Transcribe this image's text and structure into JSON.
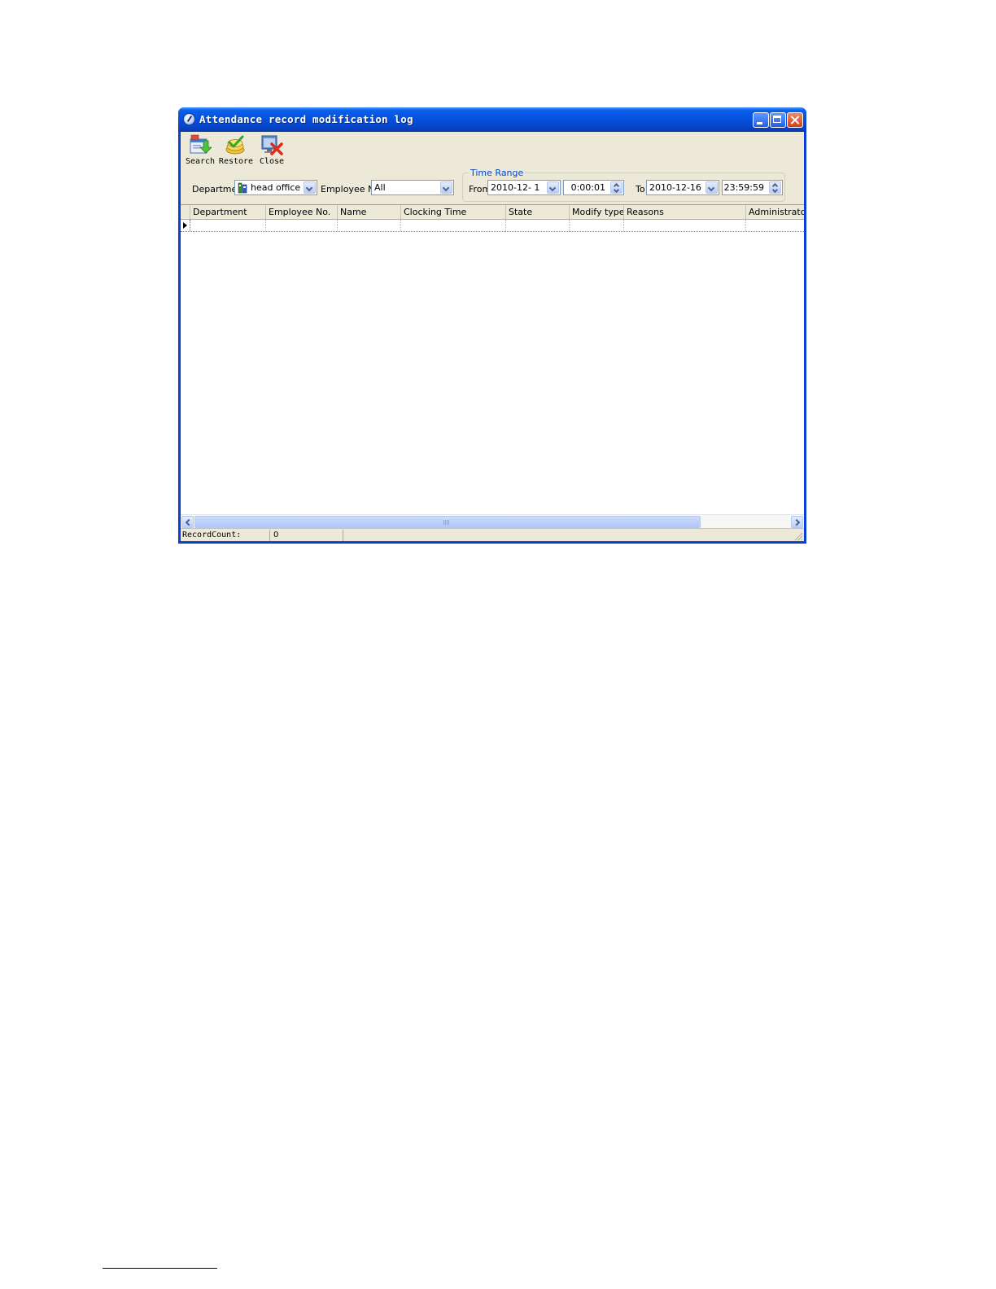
{
  "window": {
    "title": "Attendance record modification log"
  },
  "toolbar": {
    "search_label": "Search",
    "restore_label": "Restore",
    "close_label": "Close"
  },
  "filters": {
    "department_label": "Department",
    "department_value": "head office",
    "employee_label": "Employee No.",
    "employee_value": "All",
    "time_range_label": "Time Range",
    "from_label": "From",
    "from_date": "2010-12- 1",
    "from_time": "0:00:01",
    "to_label": "To",
    "to_date": "2010-12-16",
    "to_time": "23:59:59"
  },
  "grid": {
    "columns": [
      "Department",
      "Employee No.",
      "Name",
      "Clocking Time",
      "State",
      "Modify type",
      "Reasons",
      "Administrator"
    ]
  },
  "status": {
    "record_count_label": "RecordCount:",
    "record_count_value": "0"
  },
  "icons": {
    "app": "clock-icon",
    "search": "search-icon",
    "restore": "restore-icon",
    "close": "close-icon",
    "department": "department-tree-icon"
  },
  "colors": {
    "titlebar": "#0552e0",
    "face": "#ece9d8",
    "group_legend": "#0046d5"
  }
}
